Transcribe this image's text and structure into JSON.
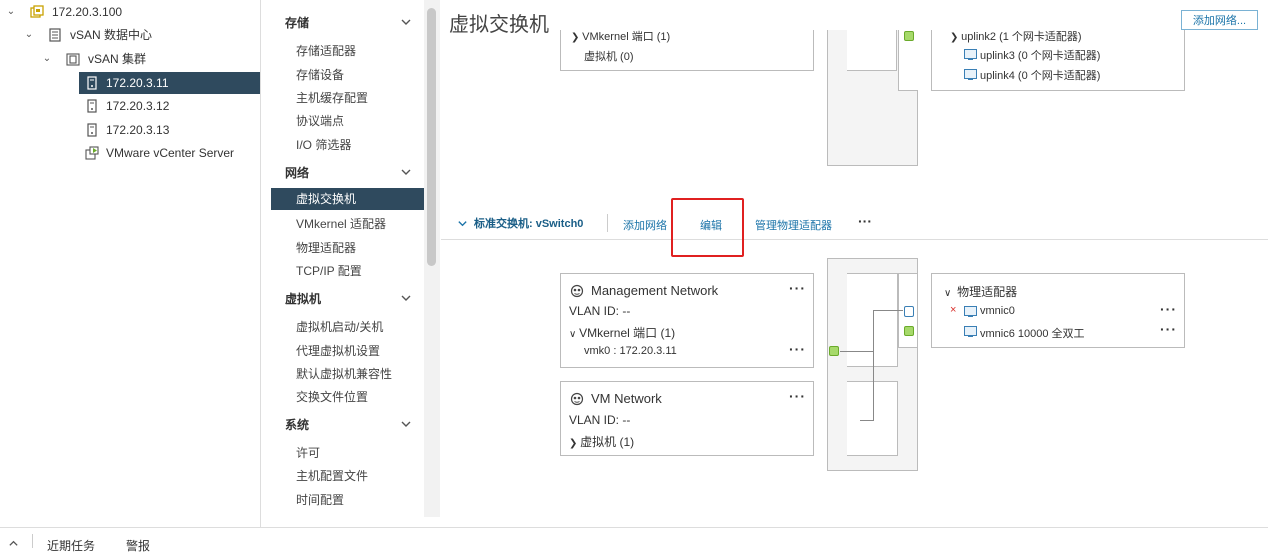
{
  "tree": {
    "host_root": "172.20.3.100",
    "datacenter": "vSAN 数据中心",
    "cluster": "vSAN 集群",
    "hosts": [
      "172.20.3.11",
      "172.20.3.12",
      "172.20.3.13"
    ],
    "vcenter": "VMware vCenter Server"
  },
  "nav": {
    "storage": {
      "title": "存储",
      "items": [
        "存储适配器",
        "存储设备",
        "主机缓存配置",
        "协议端点",
        "I/O 筛选器"
      ]
    },
    "network": {
      "title": "网络",
      "items": [
        "虚拟交换机",
        "VMkernel 适配器",
        "物理适配器",
        "TCP/IP 配置"
      ]
    },
    "vm": {
      "title": "虚拟机",
      "items": [
        "虚拟机启动/关机",
        "代理虚拟机设置",
        "默认虚拟机兼容性",
        "交换文件位置"
      ]
    },
    "system": {
      "title": "系统",
      "items": [
        "许可",
        "主机配置文件",
        "时间配置"
      ]
    }
  },
  "main": {
    "title": "虚拟交换机",
    "add_network_button": "添加网络...",
    "top": {
      "vmk_port_partial": "VMkernel 端口 (1)",
      "vm_count": "虚拟机 (0)",
      "uplink2": "uplink2 (1 个网卡适配器)",
      "uplink3": "uplink3 (0 个网卡适配器)",
      "uplink4": "uplink4 (0 个网卡适配器)"
    },
    "switch": {
      "label": "标准交换机: vSwitch0",
      "actions": {
        "add_network": "添加网络",
        "edit": "编辑",
        "manage": "管理物理适配器",
        "more": "···"
      }
    },
    "mgmt": {
      "name": "Management Network",
      "vlan": "VLAN ID: --",
      "vmk_ports": "VMkernel 端口 (1)",
      "vmk0": "vmk0 : 172.20.3.11",
      "dots": "···"
    },
    "vmnet": {
      "name": "VM Network",
      "vlan": "VLAN ID: --",
      "vms": "虚拟机 (1)",
      "dots": "···"
    },
    "physical": {
      "title": "物理适配器",
      "nics": [
        {
          "name": "vmnic0",
          "status": "×",
          "dots": "···"
        },
        {
          "name": "vmnic6 10000 全双工",
          "dots": "···"
        }
      ]
    }
  },
  "bottom": {
    "tabs": [
      "近期任务",
      "警报"
    ]
  }
}
